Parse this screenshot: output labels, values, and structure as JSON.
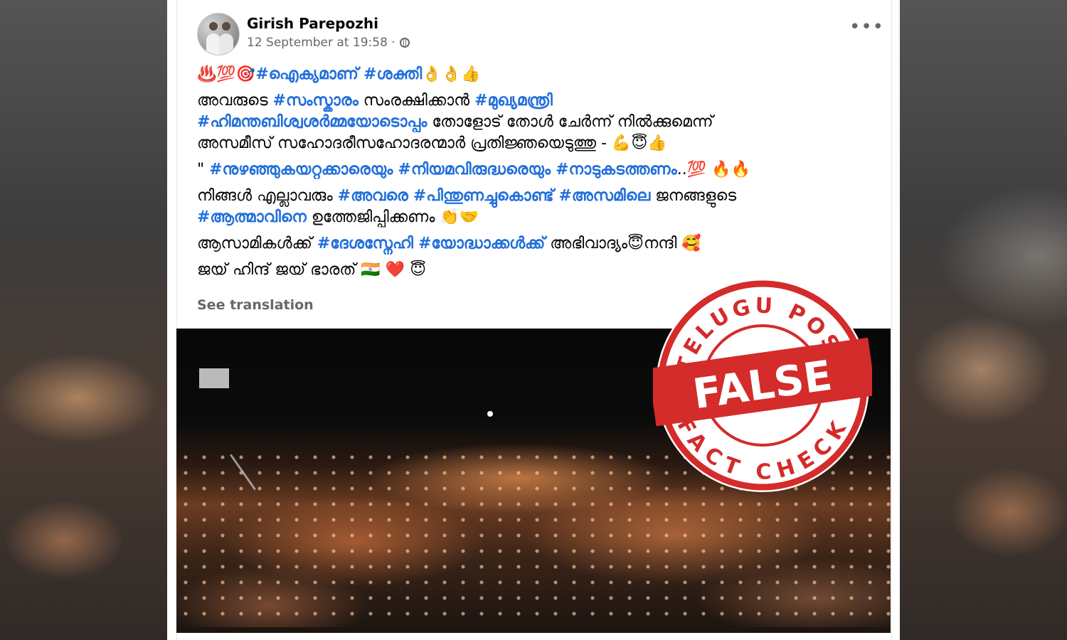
{
  "post": {
    "author": "Girish Parepozhi",
    "timestamp": "12 September at 19:58 ·",
    "privacy_icon": "globe-icon",
    "more_label": "•••",
    "see_translation": "See translation"
  },
  "lines": {
    "l1_emoji": "♨️💯🎯",
    "l1_tag1": "#ഐക്യമാണ്",
    "l1_tag2": "#ശക്തി",
    "l1_emoji_end": "👌👌👍",
    "l2_a": "അവരുടെ ",
    "l2_tag1": "#സംസ്കാരം",
    "l2_b": " സംരക്ഷിക്കാൻ ",
    "l2_tag2": "#മുഖ്യമന്ത്രി",
    "l2_tag3": "#ഹിമന്തബിശ്വശർമ്മയോടൊപ്പം",
    "l2_c": " തോളോട് തോൾ ചേർന്ന് നിൽക്കുമെന്ന്",
    "l2_d": "അസമീസ് സഹോദരീസഹോദരന്മാർ പ്രതിജ്ഞയെടുത്തു - 💪😇👍",
    "l3_a": "\" ",
    "l3_tag1": "#നുഴഞ്ഞുകയറ്റക്കാരെയും",
    "l3_tag2": "#നിയമവിരുദ്ധരെയും",
    "l3_tag3": "#നാടുകടത്തണം",
    "l3_end": "..💯 🔥🔥",
    "l4_a": "നിങ്ങൾ എല്ലാവരും ",
    "l4_tag1": "#അവരെ",
    "l4_tag2": "#പിന്തുണച്ചുകൊണ്ട്",
    "l4_tag3": "#അസമിലെ",
    "l4_b": " ജനങ്ങളുടെ",
    "l4_tag4": "#ആത്മാവിനെ",
    "l4_c": " ഉത്തേജിപ്പിക്കണം 👏🤝",
    "l5_a": "ആസാമികൾക്ക് ",
    "l5_tag1": "#ദേശസ്നേഹി",
    "l5_tag2": "#യോദ്ധാക്കൾക്ക്",
    "l5_b": " അഭിവാദ്യം😇നന്ദി 🥰",
    "l6": "ജയ് ഹിന്ദ് ജയ് ഭാരത് 🇮🇳 ❤️ 😇"
  },
  "stamp": {
    "top_text": "TELUGU POST",
    "verdict": "FALSE",
    "bottom_text": "FACT CHECK",
    "color": "#d42b2b"
  },
  "colors": {
    "hashtag": "#216fdb",
    "meta": "#65676b"
  }
}
